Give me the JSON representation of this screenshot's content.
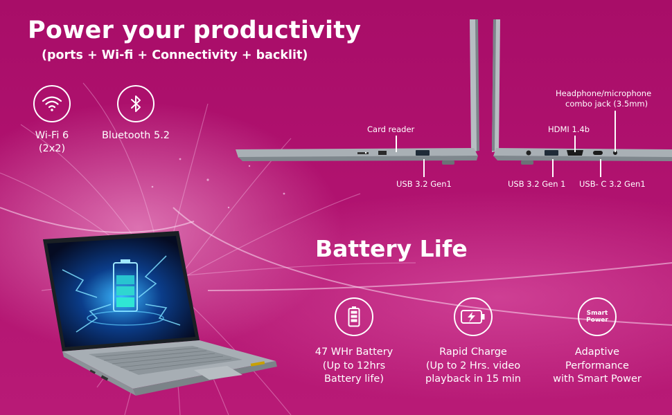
{
  "header": {
    "title": "Power your productivity",
    "subtitle": "(ports + Wi-fi + Connectivity + backlit)"
  },
  "connectivity": [
    {
      "label_line1": "Wi-Fi 6",
      "label_line2": "(2x2)",
      "icon": "wifi-icon"
    },
    {
      "label_line1": "Bluetooth 5.2",
      "label_line2": "",
      "icon": "bluetooth-icon"
    }
  ],
  "ports": {
    "card_reader": "Card reader",
    "usb_left": "USB 3.2 Gen1",
    "headphone_line1": "Headphone/microphone",
    "headphone_line2": "combo jack (3.5mm)",
    "hdmi": "HDMI 1.4b",
    "usb_right": "USB 3.2 Gen 1",
    "usb_c": "USB- C 3.2 Gen1"
  },
  "battery": {
    "title": "Battery Life",
    "features": [
      {
        "line1": "47 WHr Battery",
        "line2": "(Up to 12hrs",
        "line3": "Battery life)",
        "icon": "battery-icon"
      },
      {
        "line1": "Rapid Charge",
        "line2": "(Up to 2 Hrs. video",
        "line3": "playback in 15 min",
        "icon": "rapid-charge-icon"
      },
      {
        "line1": "Adaptive",
        "line2": "Performance",
        "line3": "with Smart Power",
        "icon": "smart-power-icon",
        "icon_text_1": "Smart",
        "icon_text_2": "Power"
      }
    ]
  },
  "colors": {
    "background": "#b0126f",
    "text": "#ffffff",
    "laptop_grey": "#9aa2a8"
  }
}
